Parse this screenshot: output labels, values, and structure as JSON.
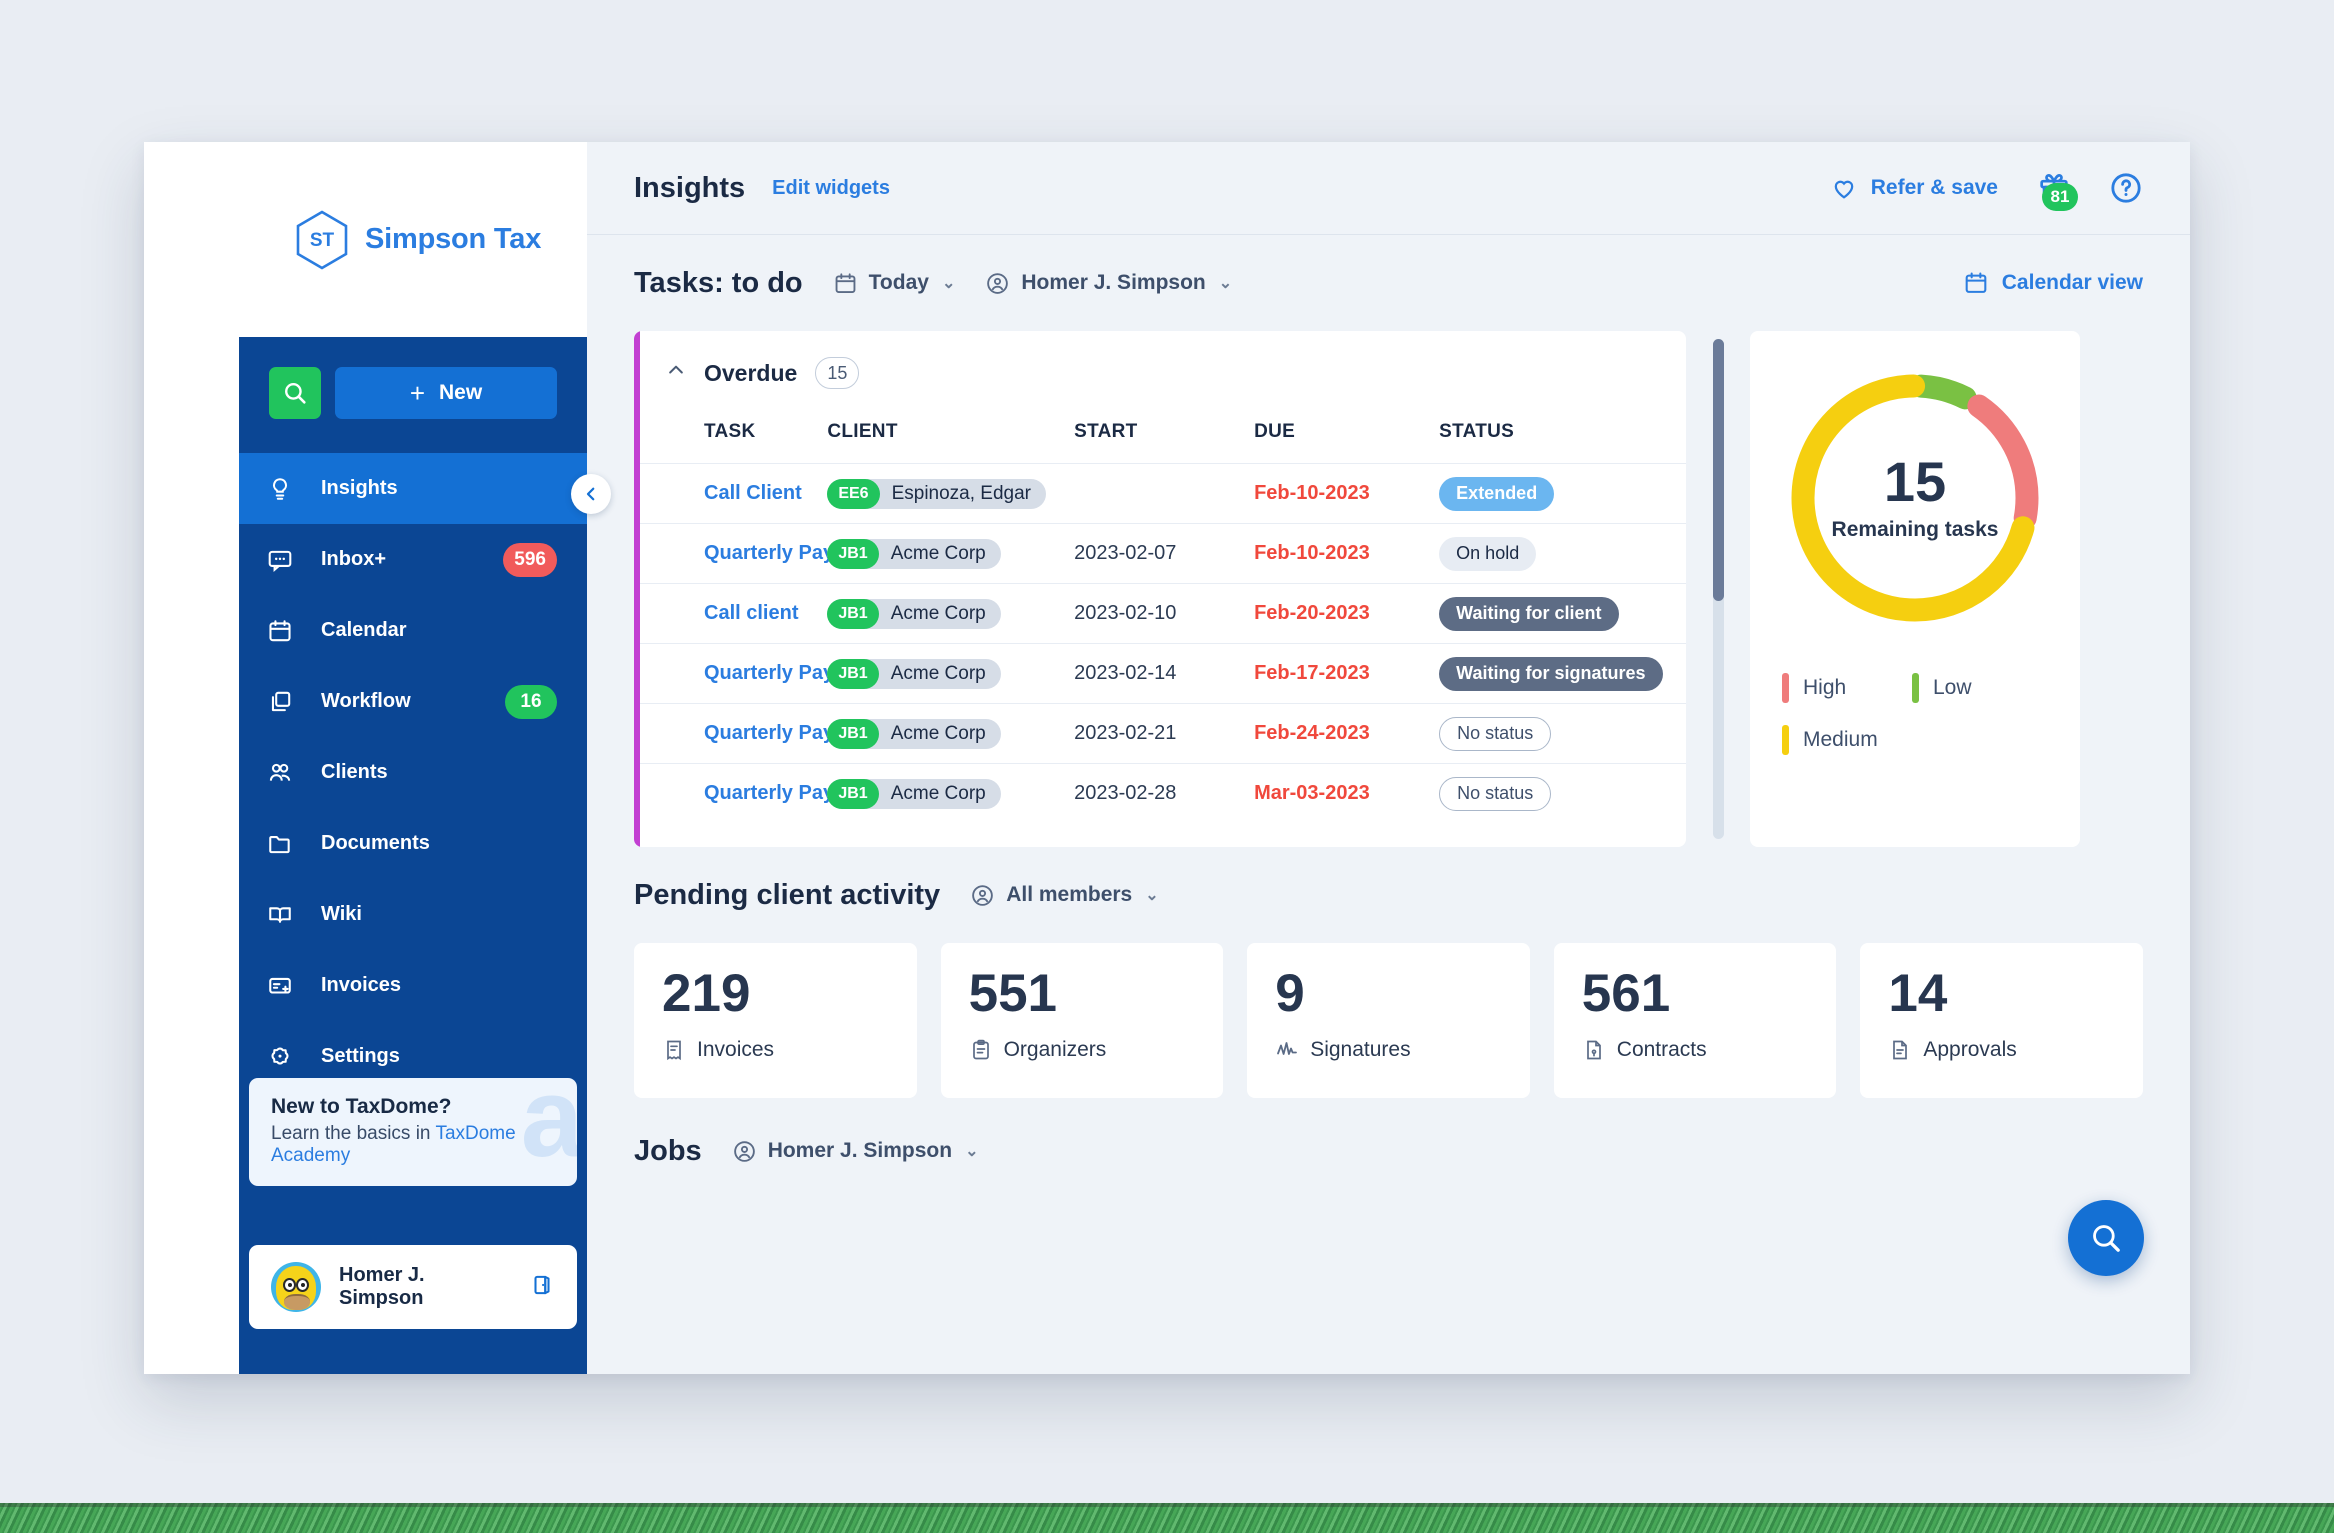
{
  "brand": {
    "logo_initials": "ST",
    "name": "Simpson Tax"
  },
  "sidebar": {
    "search_icon": "search-icon",
    "new_button": "New",
    "items": [
      {
        "label": "Insights",
        "icon": "lightbulb-icon",
        "badge": "",
        "active": true
      },
      {
        "label": "Inbox+",
        "icon": "chat-icon",
        "badge": "596",
        "active": false
      },
      {
        "label": "Calendar",
        "icon": "calendar-icon",
        "badge": "",
        "active": false
      },
      {
        "label": "Workflow",
        "icon": "layers-icon",
        "badge": "16",
        "active": false
      },
      {
        "label": "Clients",
        "icon": "people-icon",
        "badge": "",
        "active": false
      },
      {
        "label": "Documents",
        "icon": "folder-icon",
        "badge": "",
        "active": false
      },
      {
        "label": "Wiki",
        "icon": "book-icon",
        "badge": "",
        "active": false
      },
      {
        "label": "Invoices",
        "icon": "invoice-icon",
        "badge": "",
        "active": false
      },
      {
        "label": "Settings",
        "icon": "gear-icon",
        "badge": "",
        "active": false
      }
    ],
    "promo": {
      "title": "New to TaxDome?",
      "subtitle_prefix": "Learn the basics in ",
      "link": "TaxDome Academy",
      "watermark": "a"
    },
    "user": {
      "name": "Homer J. Simpson",
      "action_icon": "logout-icon"
    }
  },
  "header": {
    "title": "Insights",
    "edit_widgets": "Edit widgets",
    "refer_label": "Refer & save",
    "refer_icon": "heart-icon",
    "gift_icon": "gift-icon",
    "gift_badge": "81",
    "help_icon": "question-circle-icon"
  },
  "tasks": {
    "title": "Tasks: to do",
    "date_filter": "Today",
    "member_filter": "Homer J. Simpson",
    "calendar_view": "Calendar view",
    "group": {
      "name": "Overdue",
      "count": "15"
    },
    "columns": [
      "TASK",
      "CLIENT",
      "START",
      "DUE",
      "STATUS"
    ],
    "rows": [
      {
        "task": "Call Client",
        "client_code": "EE6",
        "client": "Espinoza, Edgar",
        "start": "",
        "due": "Feb-10-2023",
        "status": "Extended",
        "status_style": "st-extended"
      },
      {
        "task": "Quarterly Payr…",
        "client_code": "JB1",
        "client": "Acme Corp",
        "start": "2023-02-07",
        "due": "Feb-10-2023",
        "status": "On hold",
        "status_style": "st-onhold"
      },
      {
        "task": "Call client",
        "client_code": "JB1",
        "client": "Acme Corp",
        "start": "2023-02-10",
        "due": "Feb-20-2023",
        "status": "Waiting for client",
        "status_style": "st-dark"
      },
      {
        "task": "Quarterly Payr…",
        "client_code": "JB1",
        "client": "Acme Corp",
        "start": "2023-02-14",
        "due": "Feb-17-2023",
        "status": "Waiting for signatures",
        "status_style": "st-dark"
      },
      {
        "task": "Quarterly Payr…",
        "client_code": "JB1",
        "client": "Acme Corp",
        "start": "2023-02-21",
        "due": "Feb-24-2023",
        "status": "No status",
        "status_style": "st-none"
      },
      {
        "task": "Quarterly Payr…",
        "client_code": "JB1",
        "client": "Acme Corp",
        "start": "2023-02-28",
        "due": "Mar-03-2023",
        "status": "No status",
        "status_style": "st-none"
      }
    ]
  },
  "chart_data": {
    "type": "pie",
    "title": "Remaining tasks",
    "center_value": "15",
    "center_label": "Remaining tasks",
    "categories": [
      "High",
      "Low",
      "Medium"
    ],
    "values": [
      20,
      8,
      72
    ],
    "colors": [
      "#ef7c7c",
      "#7ac143",
      "#f5cf10"
    ],
    "legend": [
      {
        "label": "High",
        "color": "#ef7c7c"
      },
      {
        "label": "Low",
        "color": "#7ac143"
      },
      {
        "label": "Medium",
        "color": "#f5cf10"
      }
    ],
    "legend_position": "bottom-left",
    "grid": false
  },
  "pending": {
    "title": "Pending client activity",
    "member_filter": "All members",
    "cards": [
      {
        "value": "219",
        "label": "Invoices",
        "icon": "receipt-icon"
      },
      {
        "value": "551",
        "label": "Organizers",
        "icon": "clipboard-icon"
      },
      {
        "value": "9",
        "label": "Signatures",
        "icon": "signature-icon"
      },
      {
        "value": "561",
        "label": "Contracts",
        "icon": "contract-icon"
      },
      {
        "value": "14",
        "label": "Approvals",
        "icon": "approval-icon"
      }
    ]
  },
  "jobs": {
    "title": "Jobs",
    "member_filter": "Homer J. Simpson"
  },
  "fab": {
    "icon": "search-icon"
  },
  "colors": {
    "sidebar_bg": "#0b4694",
    "accent_blue": "#1470d4",
    "link_blue": "#2b7de0",
    "green": "#21c45d",
    "red_badge": "#f15b5b",
    "overdue_red": "#f0483c",
    "group_bar": "#c23fd2",
    "canvas": "#eff3f8"
  }
}
